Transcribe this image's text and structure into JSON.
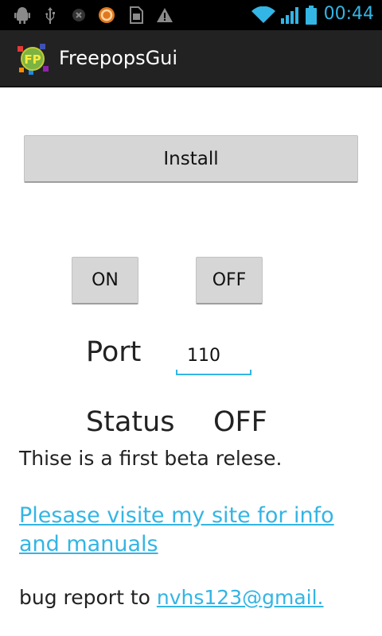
{
  "status_bar": {
    "time": "00:44",
    "icons": [
      "android-debug-icon",
      "usb-icon",
      "notification-icon",
      "app-notification-icon",
      "sim-icon",
      "warning-icon",
      "wifi-icon",
      "signal-icon",
      "battery-icon"
    ],
    "accent_color": "#33b5e5"
  },
  "action_bar": {
    "title": "FreepopsGui",
    "app_icon_text": "FP"
  },
  "main": {
    "install_label": "Install",
    "on_label": "ON",
    "off_label": "OFF",
    "port_label": "Port",
    "port_value": "110",
    "status_label": "Status",
    "status_value": "OFF",
    "beta_text": "Thise is a first beta relese.",
    "site_link": "Plesase visite my site for info and manuals",
    "bug_prefix": "bug report to ",
    "bug_email": "nvhs123@gmail."
  }
}
